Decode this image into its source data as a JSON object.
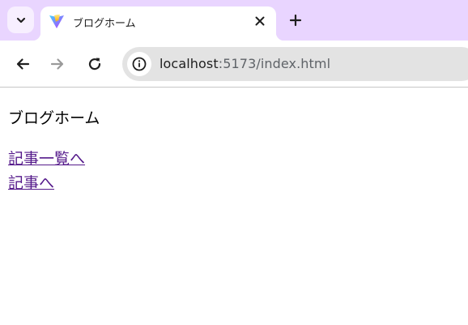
{
  "tab": {
    "title": "ブログホーム",
    "favicon": "vite-logo-icon"
  },
  "address_bar": {
    "host": "localhost",
    "path": ":5173/index.html"
  },
  "page": {
    "title": "ブログホーム",
    "links": [
      {
        "label": "記事一覧へ"
      },
      {
        "label": "記事へ"
      }
    ]
  },
  "colors": {
    "tab_strip": "#e9d5ff",
    "visited_link": "#551a8b"
  }
}
